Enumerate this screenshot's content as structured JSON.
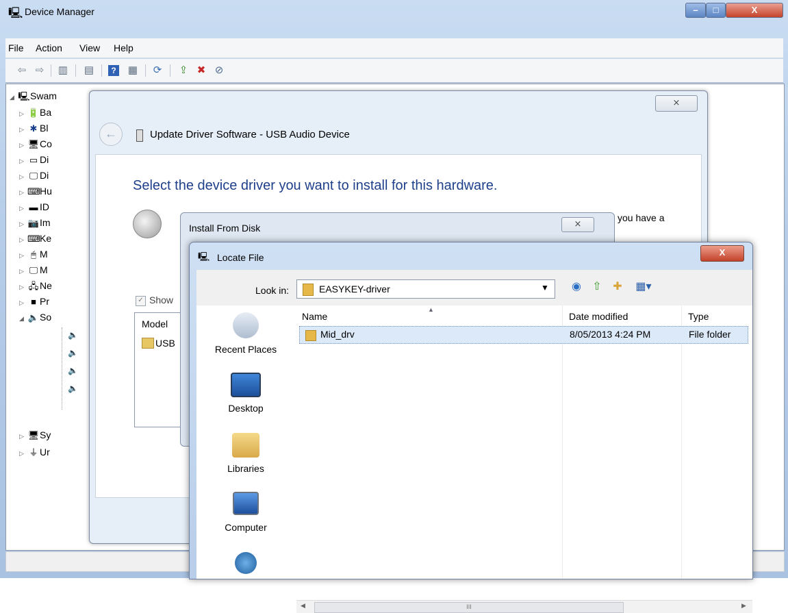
{
  "device_manager": {
    "title": "Device Manager",
    "menu": [
      "File",
      "Action",
      "View",
      "Help"
    ],
    "tree": {
      "root": "Swam",
      "items": [
        "Ba",
        "Bl",
        "Co",
        "Di",
        "Di",
        "Hu",
        "ID",
        "Im",
        "Ke",
        "M",
        "M",
        "Ne",
        "Pr",
        "So",
        "Sy",
        "Ur"
      ]
    }
  },
  "update_driver": {
    "title": "Update Driver Software - USB Audio Device",
    "heading": "Select the device driver you want to install for this hardware.",
    "description_tail": "you have a",
    "show_compatible_label": "Show",
    "model_header": "Model",
    "model_item": "USB",
    "close_glyph": "⨯"
  },
  "install_from_disk": {
    "title": "Install From Disk",
    "close_glyph": "⨯"
  },
  "locate_file": {
    "title": "Locate File",
    "look_in_label": "Look in:",
    "look_in_value": "EASYKEY-driver",
    "places": [
      "Recent Places",
      "Desktop",
      "Libraries",
      "Computer"
    ],
    "columns": [
      "Name",
      "Date modified",
      "Type"
    ],
    "files": [
      {
        "name": "Mid_drv",
        "date_modified": "8/05/2013 4:24 PM",
        "type": "File folder"
      }
    ],
    "close_glyph": "X",
    "scroll_grip": "III"
  }
}
